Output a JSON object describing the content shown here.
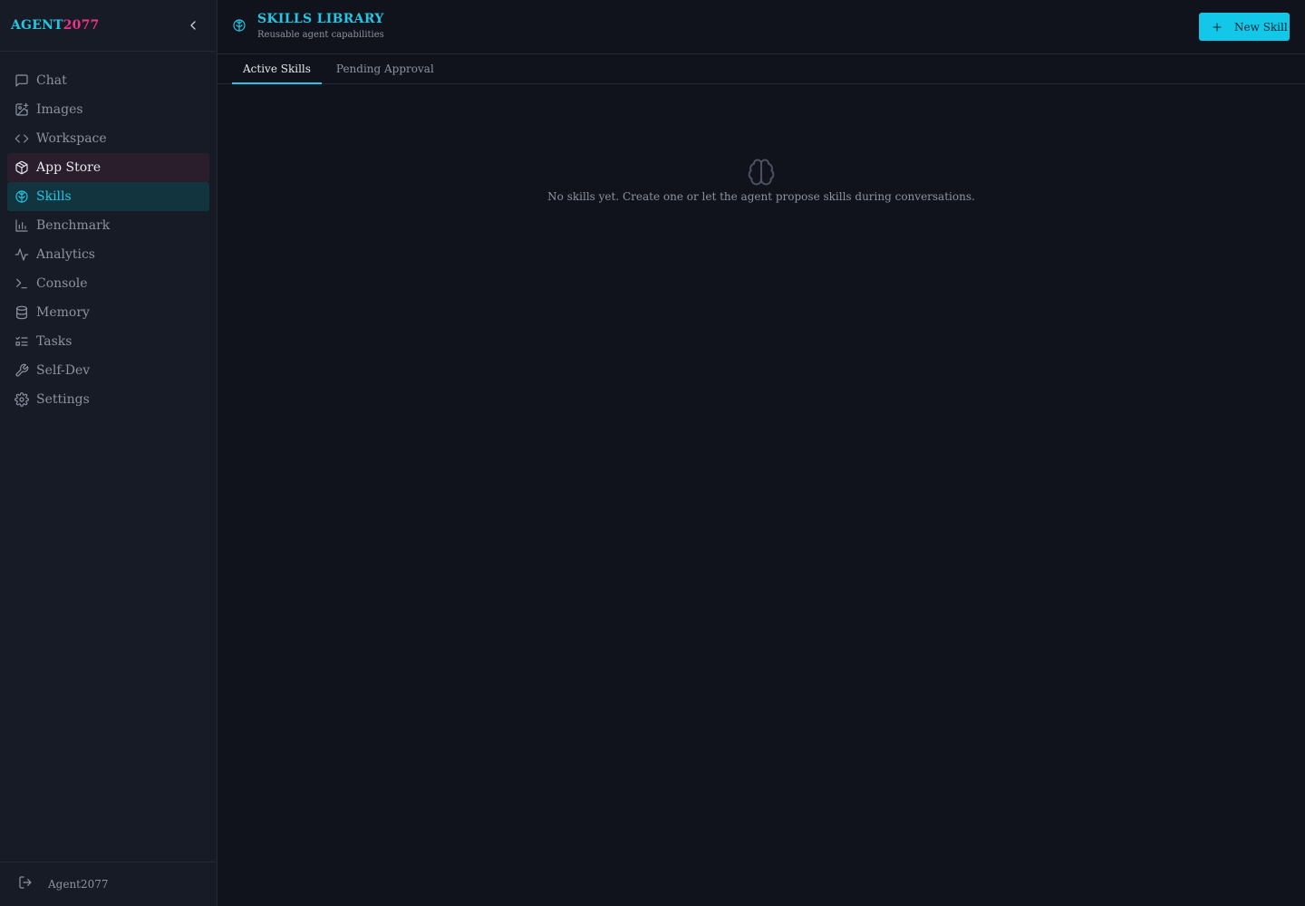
{
  "brand": {
    "part1": "AGENT",
    "part2": "2077"
  },
  "sidebar": {
    "items": [
      {
        "label": "Chat",
        "icon": "message-square-icon"
      },
      {
        "label": "Images",
        "icon": "image-plus-icon"
      },
      {
        "label": "Workspace",
        "icon": "code-icon"
      },
      {
        "label": "App Store",
        "icon": "package-icon"
      },
      {
        "label": "Skills",
        "icon": "brain-icon"
      },
      {
        "label": "Benchmark",
        "icon": "bar-chart-icon"
      },
      {
        "label": "Analytics",
        "icon": "activity-icon"
      },
      {
        "label": "Console",
        "icon": "terminal-icon"
      },
      {
        "label": "Memory",
        "icon": "database-icon"
      },
      {
        "label": "Tasks",
        "icon": "list-checks-icon"
      },
      {
        "label": "Self-Dev",
        "icon": "wrench-icon"
      },
      {
        "label": "Settings",
        "icon": "gear-icon"
      }
    ],
    "active": "Skills",
    "hovered": "App Store",
    "footer_user": "Agent2077"
  },
  "header": {
    "title": "SKILLS LIBRARY",
    "subtitle": "Reusable agent capabilities",
    "new_button": "New Skill"
  },
  "tabs": [
    {
      "label": "Active Skills",
      "active": true
    },
    {
      "label": "Pending Approval",
      "active": false
    }
  ],
  "empty_state": {
    "message": "No skills yet. Create one or let the agent propose skills during conversations."
  },
  "colors": {
    "accent": "#21c7e5",
    "brand_pink": "#e8348a",
    "background": "#10131c",
    "sidebar": "#171b25"
  }
}
